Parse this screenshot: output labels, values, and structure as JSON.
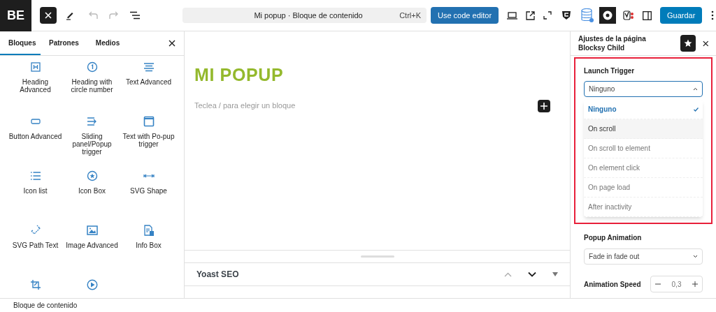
{
  "logo": {
    "text": "BE"
  },
  "toolbar": {
    "undo_disabled": true,
    "redo_disabled": true
  },
  "command_bar": {
    "title": "Mi popup · Bloque de contenido",
    "shortcut": "Ctrl+K"
  },
  "code_editor_button": "Use code editor",
  "save_button": "Guardar",
  "inserter": {
    "tabs": [
      {
        "label": "Bloques",
        "selected": true
      },
      {
        "label": "Patrones",
        "selected": false
      },
      {
        "label": "Medios",
        "selected": false
      }
    ],
    "blocks": [
      {
        "label": "Heading Advanced"
      },
      {
        "label": "Heading with circle number"
      },
      {
        "label": "Text Advanced"
      },
      {
        "label": "Button Advanced"
      },
      {
        "label": "Sliding panel/Popup trigger"
      },
      {
        "label": "Text with Po-pup trigger"
      },
      {
        "label": "Icon list"
      },
      {
        "label": "Icon Box"
      },
      {
        "label": "SVG Shape"
      },
      {
        "label": "SVG Path Text"
      },
      {
        "label": "Image Advanced"
      },
      {
        "label": "Info Box"
      }
    ]
  },
  "canvas": {
    "heading": "MI POPUP",
    "placeholder": "Teclea / para elegir un bloque"
  },
  "meta_panel": {
    "title": "Yoast SEO"
  },
  "settings": {
    "title": "Ajustes de la página Blocksy Child",
    "launch_trigger": {
      "label": "Launch Trigger",
      "value": "Ninguno",
      "expanded": true,
      "options": [
        {
          "label": "Ninguno",
          "selected": true,
          "hovered": false
        },
        {
          "label": "On scroll",
          "selected": false,
          "hovered": true
        },
        {
          "label": "On scroll to element",
          "selected": false,
          "hovered": false
        },
        {
          "label": "On element click",
          "selected": false,
          "hovered": false
        },
        {
          "label": "On page load",
          "selected": false,
          "hovered": false
        },
        {
          "label": "After inactivity",
          "selected": false,
          "hovered": false
        }
      ]
    },
    "popup_animation": {
      "label": "Popup Animation",
      "value": "Fade in fade out"
    },
    "animation_speed": {
      "label": "Animation Speed",
      "value": "0,3"
    }
  },
  "status_bar": {
    "breadcrumb": "Bloque de contenido"
  }
}
